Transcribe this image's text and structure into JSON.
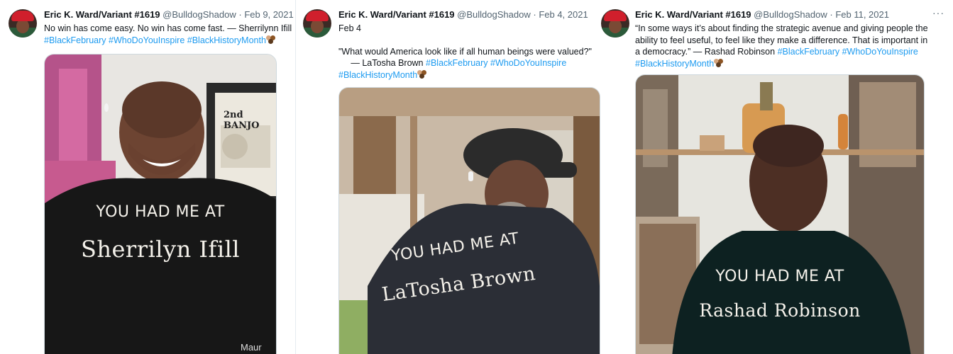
{
  "tweets": [
    {
      "author_name": "Eric K. Ward/Variant #1619",
      "handle": "@BulldogShadow",
      "separator": "·",
      "date": "Feb 9, 2021",
      "text_line1": "No win has come easy. No win has come fast.  — Sherrilynn Ifill",
      "hashtags": [
        "#BlackFebruary",
        "#WhoDoYouInspire",
        "#BlackHistoryMonth"
      ],
      "photo": {
        "shirt_line1": "YOU HAD ME AT",
        "shirt_line2": "Sherrilyn Ifill",
        "poster_text": "2nd BANJO",
        "corner_text": "Maur"
      }
    },
    {
      "author_name": "Eric K. Ward/Variant #1619",
      "handle": "@BulldogShadow",
      "separator": "·",
      "date": "Feb 4, 2021",
      "text_line1": "Feb 4",
      "text_line2": "\"What would America look like if all human beings were valued?\"",
      "text_line3": "     — LaTosha Brown",
      "hashtags": [
        "#BlackFebruary",
        "#WhoDoYouInspire",
        "#BlackHistoryMonth"
      ],
      "photo": {
        "shirt_line1": "YOU HAD ME AT",
        "shirt_line2": "LaTosha Brown"
      }
    },
    {
      "author_name": "Eric K. Ward/Variant #1619",
      "handle": "@BulldogShadow",
      "separator": "·",
      "date": "Feb 11, 2021",
      "more_label": "···",
      "text_line1": "“In some ways it’s about finding the strategic avenue and giving people the",
      "text_line2": "ability to feel useful, to feel like they make a difference. That is important in",
      "text_line3": "a democracy.” — Rashad Robinson",
      "hashtags": [
        "#BlackFebruary",
        "#WhoDoYouInspire",
        "#BlackHistoryMonth"
      ],
      "photo": {
        "shirt_line1": "YOU HAD ME AT",
        "shirt_line2": "Rashad Robinson"
      }
    }
  ],
  "colors": {
    "hashtag": "#1d9bf0",
    "meta": "#536471",
    "divider": "#e6ecf0"
  }
}
